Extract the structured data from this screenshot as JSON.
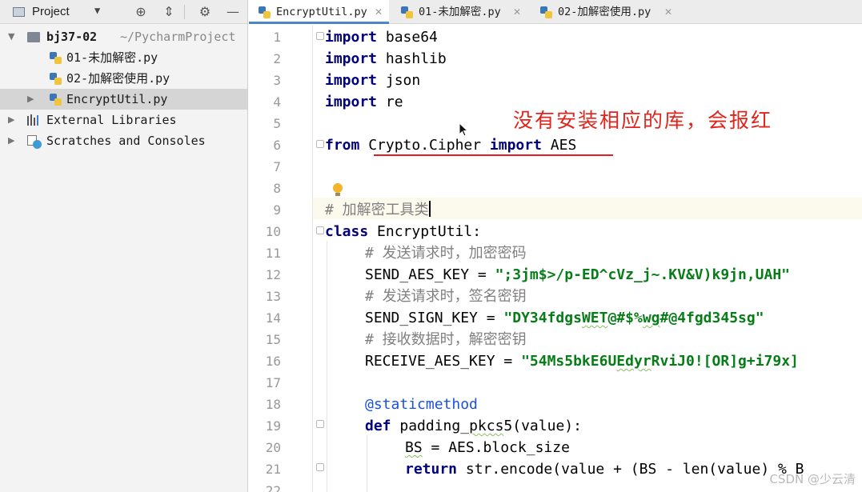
{
  "project_panel": {
    "title": "Project",
    "tools": [
      "locate-icon",
      "collapse-icon",
      "gear-icon",
      "minimize-icon"
    ],
    "tree": [
      {
        "label": "bj37-02",
        "path": "~/PycharmProject",
        "type": "folder",
        "expanded": true
      },
      {
        "label": "01-未加解密.py",
        "type": "python-file"
      },
      {
        "label": "02-加解密使用.py",
        "type": "python-file"
      },
      {
        "label": "EncryptUtil.py",
        "type": "python-file",
        "selected": true
      },
      {
        "label": "External Libraries",
        "type": "libraries"
      },
      {
        "label": "Scratches and Consoles",
        "type": "scratches"
      }
    ]
  },
  "tabs": [
    {
      "label": "EncryptUtil.py",
      "active": true
    },
    {
      "label": "01-未加解密.py",
      "active": false
    },
    {
      "label": "02-加解密使用.py",
      "active": false
    }
  ],
  "editor": {
    "current_line": 9,
    "line_numbers": [
      "1",
      "2",
      "3",
      "4",
      "5",
      "6",
      "7",
      "8",
      "9",
      "10",
      "11",
      "12",
      "13",
      "14",
      "15",
      "16",
      "17",
      "18",
      "19",
      "20",
      "21",
      "22"
    ]
  },
  "code": {
    "l1": {
      "kw": "import",
      "rest": " base64"
    },
    "l2": {
      "kw": "import",
      "rest": " hashlib"
    },
    "l3": {
      "kw": "import",
      "rest": " json"
    },
    "l4": {
      "kw": "import",
      "rest": " re"
    },
    "l6": {
      "kw1": "from",
      "mod": " Crypto.Cipher ",
      "kw2": "import",
      "rest": " AES"
    },
    "l9": {
      "comment": "# 加解密工具类"
    },
    "l10": {
      "kw": "class",
      "rest": " EncryptUtil:"
    },
    "l11": {
      "comment": "# 发送请求时，加密密码"
    },
    "l12": {
      "name": "SEND_AES_KEY = ",
      "value": "\";3jm$>/p-ED^cVz_j~.KV&V)k9jn,UAH\""
    },
    "l13": {
      "comment": "# 发送请求时，签名密钥"
    },
    "l14": {
      "name": "SEND_SIGN_KEY = ",
      "value_a": "\"DY34fdgs",
      "value_b": "WET",
      "value_c": "@#$%",
      "value_d": "wg",
      "value_e": "#@4fgd345sg\""
    },
    "l15": {
      "comment": "# 接收数据时，解密密钥"
    },
    "l16": {
      "name": "RECEIVE_AES_KEY = ",
      "value_a": "\"54Ms5bkE6U",
      "value_b": "Edyr",
      "value_c": "RviJ0![OR]g+i79x]"
    },
    "l18": {
      "decorator": "@staticmethod"
    },
    "l19": {
      "kw": "def",
      "fn_a": " padding_",
      "fn_b": "pkcs",
      "fn_c": "5(value):"
    },
    "l20": {
      "a": "BS",
      "b": " = AES.block_size"
    },
    "l21": {
      "kw": "return",
      "rest": " str.encode(value + (BS - len(value) % B"
    }
  },
  "annotation": "没有安装相应的库，会报红",
  "watermark": "CSDN @少云清",
  "colors": {
    "keyword": "#000080",
    "string": "#067d17",
    "comment": "#808080",
    "decorator": "#1750eb",
    "annotation": "#e0251c",
    "current_line": "#fcfaed",
    "active_tab_underline": "#4a86c8"
  }
}
